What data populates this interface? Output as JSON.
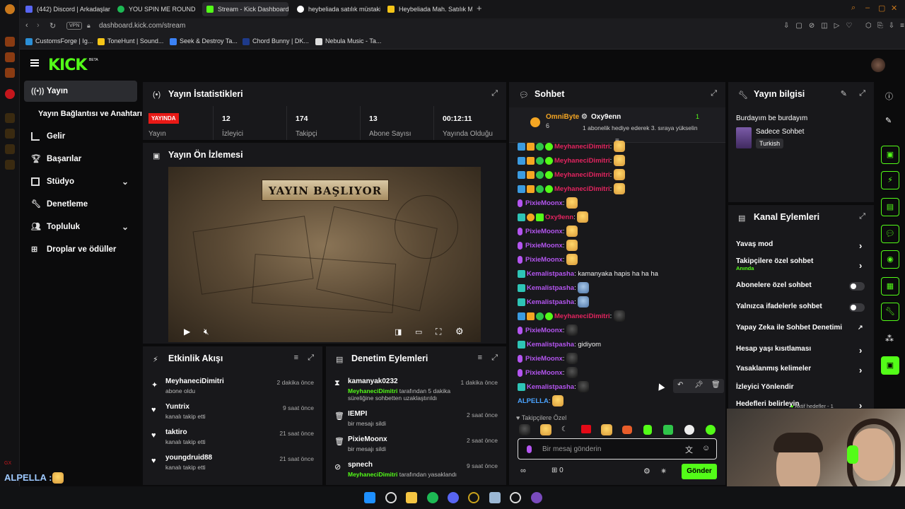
{
  "browser": {
    "tabs": [
      {
        "label": "(442) Discord | Arkadaşlar",
        "color": "#5865f2"
      },
      {
        "label": "YOU SPIN ME ROUND",
        "color": "#1db954"
      },
      {
        "label": "Stream - Kick Dashboard",
        "color": "#53fc18"
      },
      {
        "label": "heybeliada satılık müstakil",
        "color": "#ffffff"
      },
      {
        "label": "Heybeliada Mah. Satılık Mü",
        "color": "#f5c518"
      }
    ],
    "url": "dashboard.kick.com/stream",
    "vpn_label": "VPN",
    "bookmarks": [
      {
        "label": "CustomsForge | Ig...",
        "color": "#2b8fd6"
      },
      {
        "label": "ToneHunt | Sound...",
        "color": "#222222"
      },
      {
        "label": "Seek & Destroy Ta...",
        "color": "#3b82f6"
      },
      {
        "label": "Chord Bunny | DK...",
        "color": "#1e3a8a"
      },
      {
        "label": "Nebula Music - Ta...",
        "color": "#dddddd"
      }
    ]
  },
  "app": {
    "logo": "KICK",
    "logo_beta": "BETA"
  },
  "nav": {
    "items": [
      {
        "label": "Yayın",
        "icon": "broadcast-icon"
      },
      {
        "label": "Yayın Bağlantısı ve Anahtarı",
        "icon": ""
      },
      {
        "label": "Gelir",
        "icon": "chart-icon"
      },
      {
        "label": "Başarılar",
        "icon": "trophy-icon"
      },
      {
        "label": "Stüdyo",
        "icon": "grid-icon"
      },
      {
        "label": "Denetleme",
        "icon": "wrench-icon"
      },
      {
        "label": "Topluluk",
        "icon": "people-icon"
      },
      {
        "label": "Droplar ve ödüller",
        "icon": "gift-icon"
      }
    ]
  },
  "stats": {
    "title": "Yayın İstatistikleri",
    "live_badge": "YAYINDA",
    "cells": [
      {
        "value": "",
        "label": "Yayın"
      },
      {
        "value": "12",
        "label": "İzleyici"
      },
      {
        "value": "174",
        "label": "Takipçi"
      },
      {
        "value": "13",
        "label": "Abone Sayısı"
      },
      {
        "value": "00:12:11",
        "label": "Yayında Olduğu"
      }
    ]
  },
  "preview": {
    "title": "Yayın Ön İzlemesi",
    "banner_text": "YAYIN BAŞLIYOR"
  },
  "activity": {
    "title": "Etkinlik Akışı",
    "items": [
      {
        "name": "MeyhaneciDimitri",
        "sub": "abone oldu",
        "time": "2 dakika önce",
        "icon": "sparkle-icon"
      },
      {
        "name": "Yuntrix",
        "sub": "kanalı takip etti",
        "time": "9 saat önce",
        "icon": "heart-icon"
      },
      {
        "name": "taktiro",
        "sub": "kanalı takip etti",
        "time": "21 saat önce",
        "icon": "heart-icon"
      },
      {
        "name": "youngdruid88",
        "sub": "kanalı takip etti",
        "time": "21 saat önce",
        "icon": "heart-icon"
      }
    ]
  },
  "moderation": {
    "title": "Denetim Eylemleri",
    "items": [
      {
        "name": "kamanyak0232",
        "actor": "MeyhaneciDimitri",
        "sub": "tarafından 5 dakika süreliğine sohbetten uzaklaştırıldı",
        "time": "1 dakika önce",
        "icon": "hourglass-icon"
      },
      {
        "name": "IEMPI",
        "actor": "",
        "sub": "bir mesajı sildi",
        "time": "2 saat önce",
        "icon": "trash-icon"
      },
      {
        "name": "PixieMoonx",
        "actor": "",
        "sub": "bir mesajı sildi",
        "time": "2 saat önce",
        "icon": "trash-icon"
      },
      {
        "name": "spnech",
        "actor": "MeyhaneciDimitri",
        "sub": "tarafından yasaklandı",
        "time": "9 saat önce",
        "icon": "ban-icon"
      }
    ]
  },
  "chat": {
    "title": "Sohbet",
    "pinned": {
      "gifter": "OmniByte",
      "gifter_count": "6",
      "recipient": "Oxy9enn",
      "recipient_count": "1",
      "text": "1 abonelik hediye ederek 3. sıraya yükselin"
    },
    "messages": [
      {
        "user": "MeyhaneciDimitri",
        "text": "",
        "color": "#e2245f",
        "emote": "gold"
      },
      {
        "user": "MeyhaneciDimitri",
        "text": "",
        "color": "#e2245f",
        "emote": "gold"
      },
      {
        "user": "MeyhaneciDimitri",
        "text": "",
        "color": "#e2245f",
        "emote": "gold"
      },
      {
        "user": "MeyhaneciDimitri",
        "text": "",
        "color": "#e2245f",
        "emote": "gold"
      },
      {
        "user": "PixieMoonx",
        "text": "",
        "color": "#b455f0",
        "emote": "gold"
      },
      {
        "user": "Oxy9enn",
        "text": "",
        "color": "#e2245f",
        "emote": "gold"
      },
      {
        "user": "PixieMoonx",
        "text": "",
        "color": "#b455f0",
        "emote": "gold"
      },
      {
        "user": "PixieMoonx",
        "text": "",
        "color": "#b455f0",
        "emote": "gold"
      },
      {
        "user": "PixieMoonx",
        "text": "",
        "color": "#b455f0",
        "emote": "gold"
      },
      {
        "user": "Kemalistpasha",
        "text": "kamanyaka hapis ha ha ha",
        "color": "#b455f0",
        "emote": ""
      },
      {
        "user": "Kemalistpasha",
        "text": "",
        "color": "#b455f0",
        "emote": "anime"
      },
      {
        "user": "Kemalistpasha",
        "text": "",
        "color": "#b455f0",
        "emote": "anime"
      },
      {
        "user": "MeyhaneciDimitri",
        "text": "",
        "color": "#e2245f",
        "emote": "dark"
      },
      {
        "user": "PixieMoonx",
        "text": "",
        "color": "#b455f0",
        "emote": "dark"
      },
      {
        "user": "Kemalistpasha",
        "text": "gidiyom",
        "color": "#b455f0",
        "emote": ""
      },
      {
        "user": "PixieMoonx",
        "text": "",
        "color": "#b455f0",
        "emote": "dark"
      },
      {
        "user": "PixieMoonx",
        "text": "",
        "color": "#b455f0",
        "emote": "dark"
      },
      {
        "user": "Kemalistpasha",
        "text": "",
        "color": "#b455f0",
        "emote": "dark"
      },
      {
        "user": "ALPELLA",
        "text": "",
        "color": "#4aa3ff",
        "emote": "gold"
      }
    ],
    "followers_label": "Takipçilere Özel",
    "input_placeholder": "Bir mesaj gönderin",
    "points": "0",
    "send_label": "Gönder"
  },
  "stream_info": {
    "title": "Yayın bilgisi",
    "stream_title": "Burdayım be burdayım",
    "category": "Sadece Sohbet",
    "tag": "Turkish"
  },
  "channel_actions": {
    "title": "Kanal Eylemleri",
    "items": [
      {
        "label": "Yavaş mod",
        "sub": "",
        "control": "chevron"
      },
      {
        "label": "Takipçilere özel sohbet",
        "sub": "Anında",
        "control": "chevron"
      },
      {
        "label": "Abonelere özel sohbet",
        "sub": "",
        "control": "toggle"
      },
      {
        "label": "Yalnızca ifadelerle sohbet",
        "sub": "",
        "control": "toggle"
      },
      {
        "label": "Yapay Zeka ile Sohbet Denetimi",
        "sub": "",
        "control": "external"
      },
      {
        "label": "Hesap yaşı kısıtlaması",
        "sub": "",
        "control": "chevron"
      },
      {
        "label": "Yasaklanmış kelimeler",
        "sub": "",
        "control": "chevron"
      },
      {
        "label": "İzleyici Yönlendir",
        "sub": "",
        "control": "none"
      },
      {
        "label": "Hedefleri belirleyin",
        "sub": "",
        "control": "chevron"
      }
    ],
    "goal_status": "Aktif hedefler - 1"
  },
  "overlay": {
    "chat_user": "ALPELLA :"
  },
  "colors": {
    "accent": "#53fc18",
    "panel": "#18181b",
    "bg": "#0b0b0c",
    "live": "#e91916"
  }
}
